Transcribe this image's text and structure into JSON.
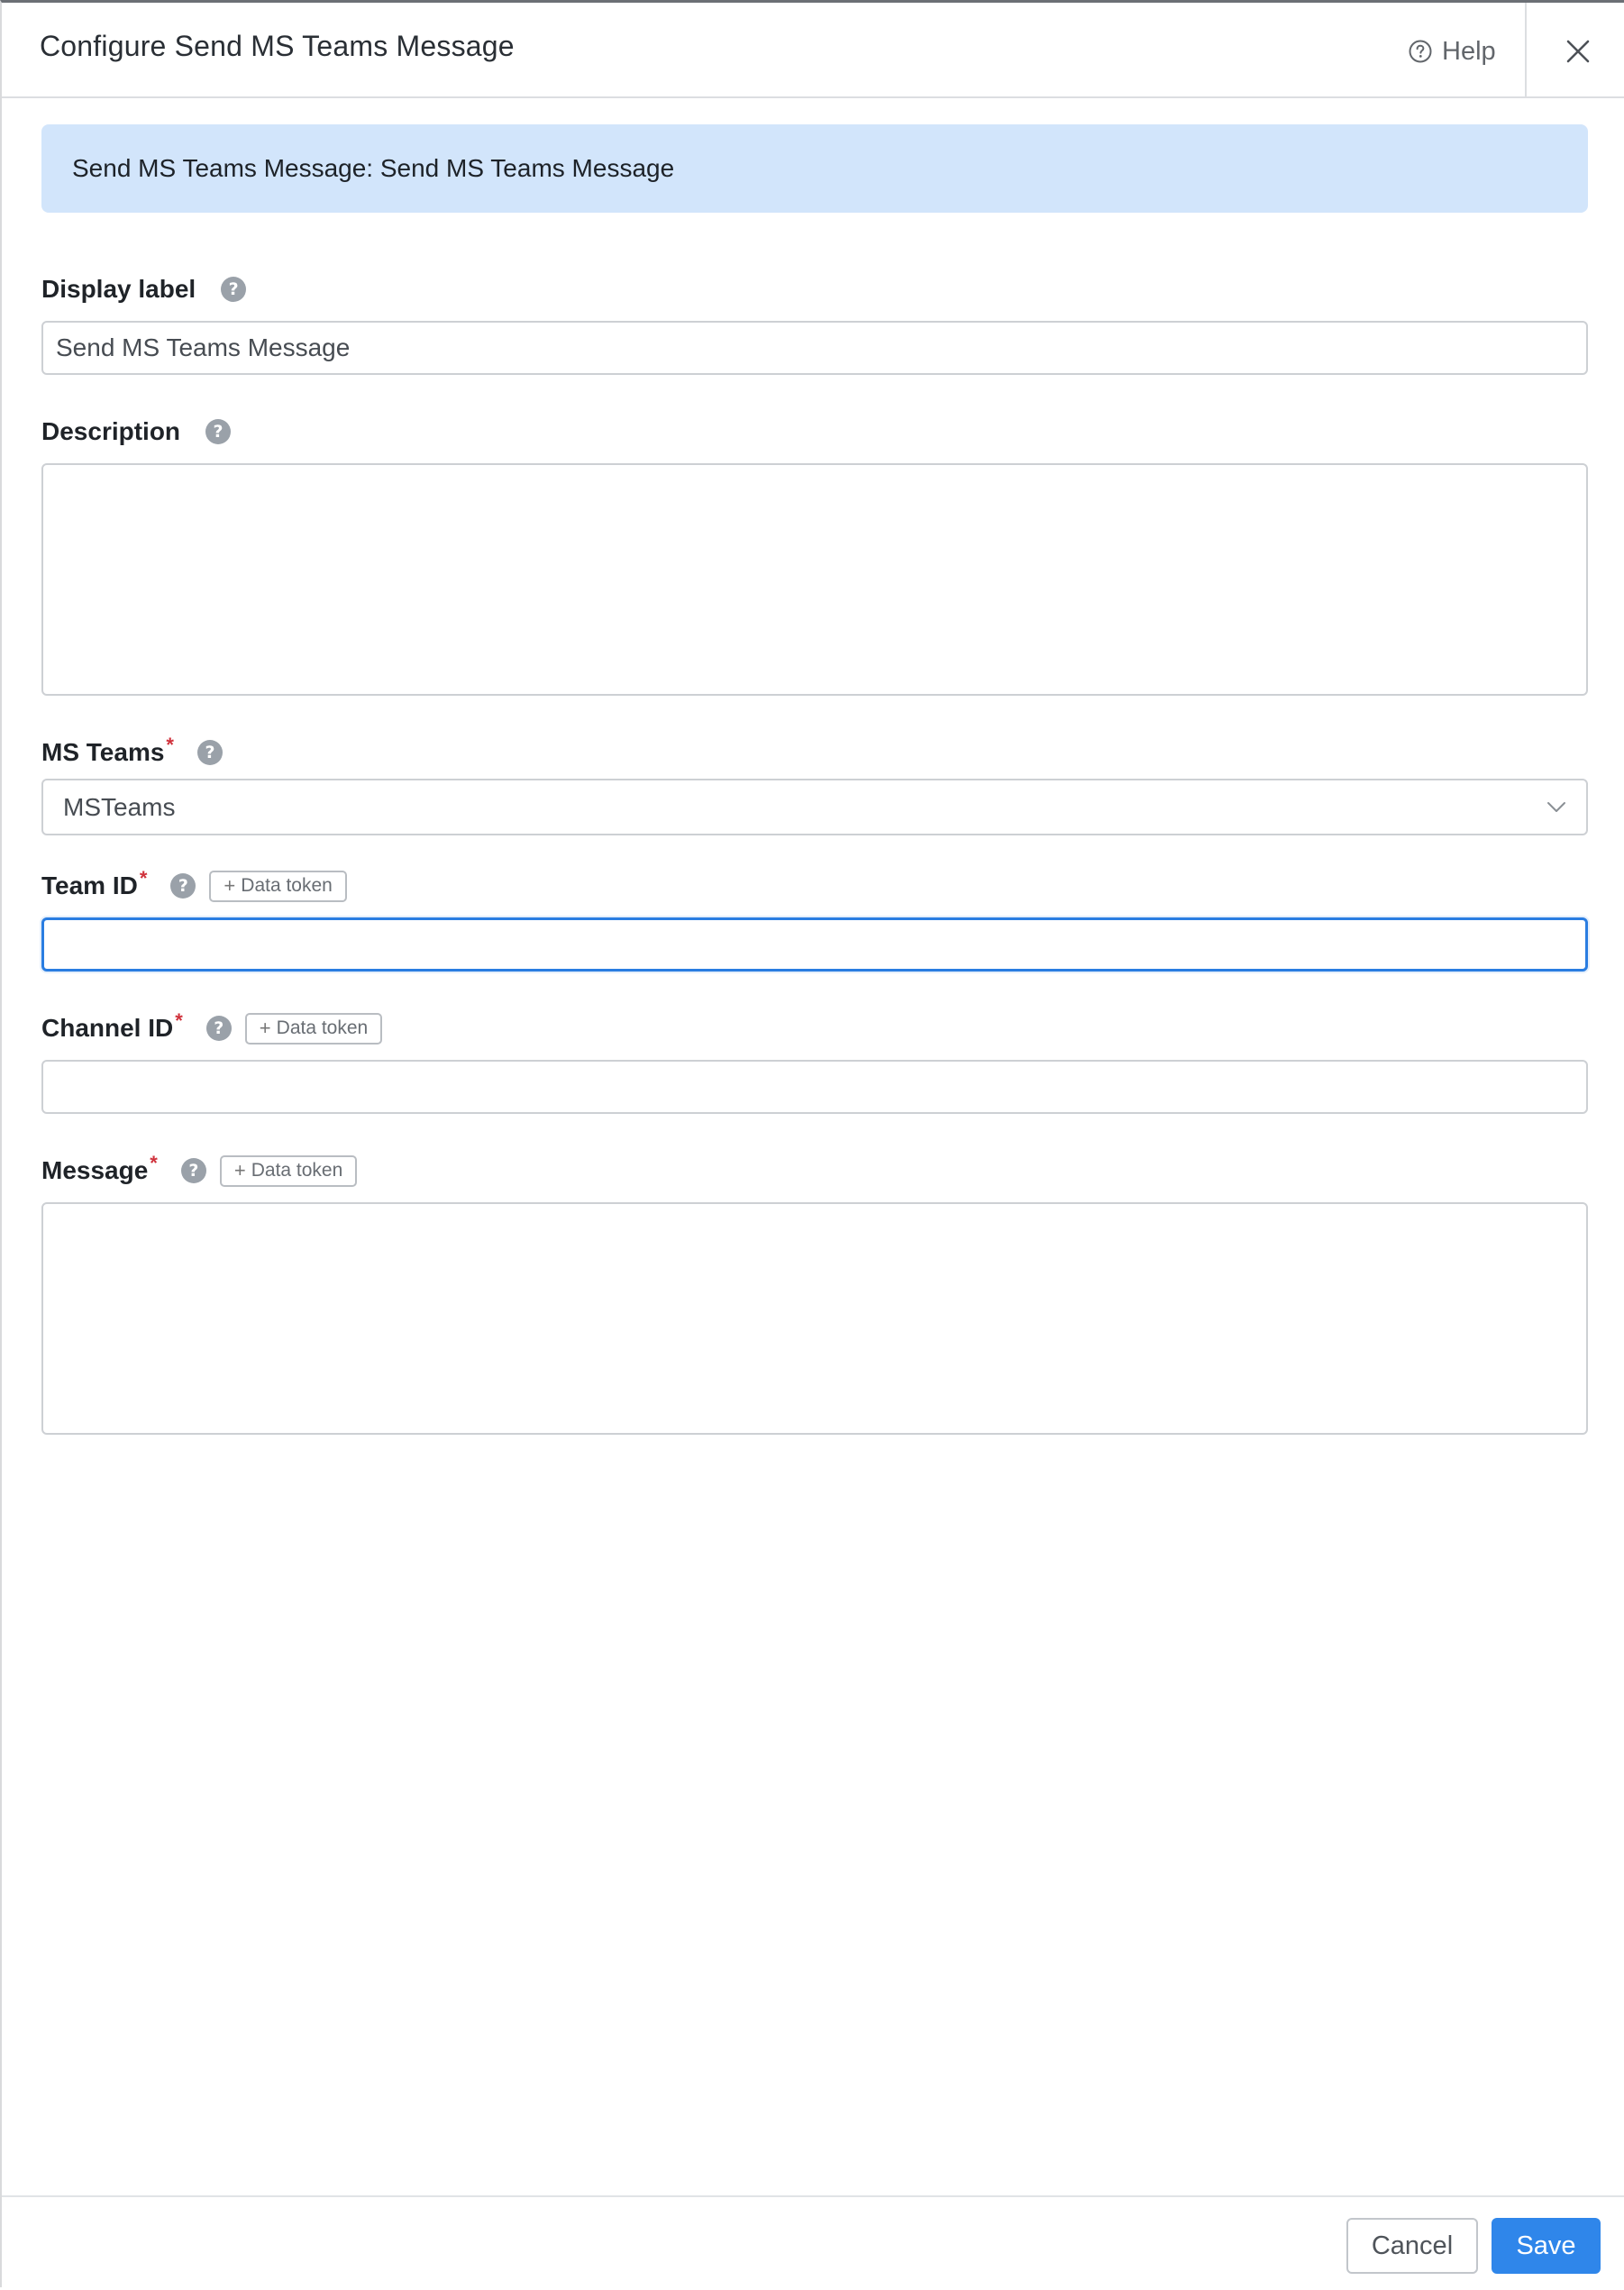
{
  "dialog": {
    "title": "Configure Send MS Teams Message",
    "help_label": "Help"
  },
  "banner": {
    "text": "Send MS Teams Message: Send MS Teams Message"
  },
  "fields": {
    "display_label": {
      "label": "Display label",
      "value": "Send MS Teams Message",
      "required": false
    },
    "description": {
      "label": "Description",
      "value": "",
      "required": false
    },
    "ms_teams": {
      "label": "MS Teams",
      "required_mark": "*",
      "selected": "MSTeams"
    },
    "team_id": {
      "label": "Team ID",
      "required_mark": "*",
      "token_label": "Data token",
      "value": ""
    },
    "channel_id": {
      "label": "Channel ID",
      "required_mark": "*",
      "token_label": "Data token",
      "value": ""
    },
    "message": {
      "label": "Message",
      "required_mark": "*",
      "token_label": "Data token",
      "value": ""
    }
  },
  "footer": {
    "cancel_label": "Cancel",
    "save_label": "Save"
  },
  "icons": {
    "help": "question-circle-icon",
    "close": "close-icon",
    "field_help": "question-icon",
    "select_arrow": "chevron-down-icon",
    "token_plus": "plus-icon"
  },
  "colors": {
    "accent": "#2f86ea",
    "focus_border": "#2a7de1",
    "banner_bg": "#d2e5fb",
    "required": "#d0323c"
  }
}
